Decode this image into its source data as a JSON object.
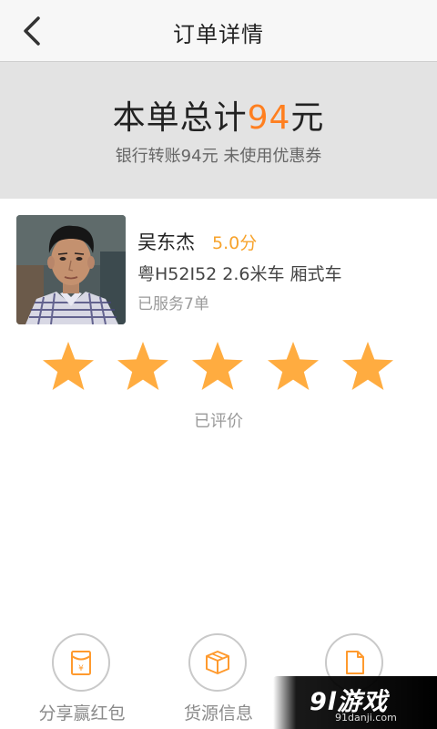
{
  "header": {
    "back_icon": "chevron-left-icon",
    "title": "订单详情"
  },
  "summary": {
    "total_prefix": "本单总计",
    "total_amount": "94",
    "total_suffix": "元",
    "payment_note": "银行转账94元 未使用优惠券",
    "amount_color": "#ff7f1f"
  },
  "driver": {
    "name": "吴东杰",
    "score": "5.0分",
    "vehicle": "粤H52I52 2.6米车 厢式车",
    "served": "已服务7单"
  },
  "rating": {
    "stars": 5,
    "max_stars": 5,
    "status": "已评价",
    "star_color": "#ffac40"
  },
  "actions": [
    {
      "label": "分享赢红包",
      "icon": "red-envelope-icon"
    },
    {
      "label": "货源信息",
      "icon": "package-box-icon"
    },
    {
      "label": "",
      "icon": "document-icon"
    }
  ],
  "watermark": {
    "logo": "9l游戏",
    "site": "91danji.com"
  }
}
